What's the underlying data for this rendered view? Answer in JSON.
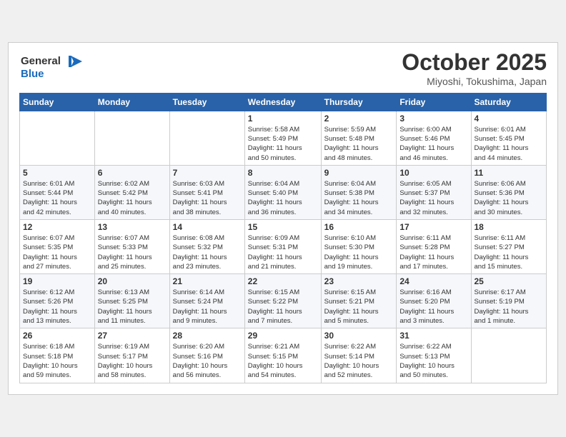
{
  "header": {
    "logo_line1": "General",
    "logo_line2": "Blue",
    "month": "October 2025",
    "location": "Miyoshi, Tokushima, Japan"
  },
  "weekdays": [
    "Sunday",
    "Monday",
    "Tuesday",
    "Wednesday",
    "Thursday",
    "Friday",
    "Saturday"
  ],
  "weeks": [
    [
      {
        "day": "",
        "info": ""
      },
      {
        "day": "",
        "info": ""
      },
      {
        "day": "",
        "info": ""
      },
      {
        "day": "1",
        "info": "Sunrise: 5:58 AM\nSunset: 5:49 PM\nDaylight: 11 hours\nand 50 minutes."
      },
      {
        "day": "2",
        "info": "Sunrise: 5:59 AM\nSunset: 5:48 PM\nDaylight: 11 hours\nand 48 minutes."
      },
      {
        "day": "3",
        "info": "Sunrise: 6:00 AM\nSunset: 5:46 PM\nDaylight: 11 hours\nand 46 minutes."
      },
      {
        "day": "4",
        "info": "Sunrise: 6:01 AM\nSunset: 5:45 PM\nDaylight: 11 hours\nand 44 minutes."
      }
    ],
    [
      {
        "day": "5",
        "info": "Sunrise: 6:01 AM\nSunset: 5:44 PM\nDaylight: 11 hours\nand 42 minutes."
      },
      {
        "day": "6",
        "info": "Sunrise: 6:02 AM\nSunset: 5:42 PM\nDaylight: 11 hours\nand 40 minutes."
      },
      {
        "day": "7",
        "info": "Sunrise: 6:03 AM\nSunset: 5:41 PM\nDaylight: 11 hours\nand 38 minutes."
      },
      {
        "day": "8",
        "info": "Sunrise: 6:04 AM\nSunset: 5:40 PM\nDaylight: 11 hours\nand 36 minutes."
      },
      {
        "day": "9",
        "info": "Sunrise: 6:04 AM\nSunset: 5:38 PM\nDaylight: 11 hours\nand 34 minutes."
      },
      {
        "day": "10",
        "info": "Sunrise: 6:05 AM\nSunset: 5:37 PM\nDaylight: 11 hours\nand 32 minutes."
      },
      {
        "day": "11",
        "info": "Sunrise: 6:06 AM\nSunset: 5:36 PM\nDaylight: 11 hours\nand 30 minutes."
      }
    ],
    [
      {
        "day": "12",
        "info": "Sunrise: 6:07 AM\nSunset: 5:35 PM\nDaylight: 11 hours\nand 27 minutes."
      },
      {
        "day": "13",
        "info": "Sunrise: 6:07 AM\nSunset: 5:33 PM\nDaylight: 11 hours\nand 25 minutes."
      },
      {
        "day": "14",
        "info": "Sunrise: 6:08 AM\nSunset: 5:32 PM\nDaylight: 11 hours\nand 23 minutes."
      },
      {
        "day": "15",
        "info": "Sunrise: 6:09 AM\nSunset: 5:31 PM\nDaylight: 11 hours\nand 21 minutes."
      },
      {
        "day": "16",
        "info": "Sunrise: 6:10 AM\nSunset: 5:30 PM\nDaylight: 11 hours\nand 19 minutes."
      },
      {
        "day": "17",
        "info": "Sunrise: 6:11 AM\nSunset: 5:28 PM\nDaylight: 11 hours\nand 17 minutes."
      },
      {
        "day": "18",
        "info": "Sunrise: 6:11 AM\nSunset: 5:27 PM\nDaylight: 11 hours\nand 15 minutes."
      }
    ],
    [
      {
        "day": "19",
        "info": "Sunrise: 6:12 AM\nSunset: 5:26 PM\nDaylight: 11 hours\nand 13 minutes."
      },
      {
        "day": "20",
        "info": "Sunrise: 6:13 AM\nSunset: 5:25 PM\nDaylight: 11 hours\nand 11 minutes."
      },
      {
        "day": "21",
        "info": "Sunrise: 6:14 AM\nSunset: 5:24 PM\nDaylight: 11 hours\nand 9 minutes."
      },
      {
        "day": "22",
        "info": "Sunrise: 6:15 AM\nSunset: 5:22 PM\nDaylight: 11 hours\nand 7 minutes."
      },
      {
        "day": "23",
        "info": "Sunrise: 6:15 AM\nSunset: 5:21 PM\nDaylight: 11 hours\nand 5 minutes."
      },
      {
        "day": "24",
        "info": "Sunrise: 6:16 AM\nSunset: 5:20 PM\nDaylight: 11 hours\nand 3 minutes."
      },
      {
        "day": "25",
        "info": "Sunrise: 6:17 AM\nSunset: 5:19 PM\nDaylight: 11 hours\nand 1 minute."
      }
    ],
    [
      {
        "day": "26",
        "info": "Sunrise: 6:18 AM\nSunset: 5:18 PM\nDaylight: 10 hours\nand 59 minutes."
      },
      {
        "day": "27",
        "info": "Sunrise: 6:19 AM\nSunset: 5:17 PM\nDaylight: 10 hours\nand 58 minutes."
      },
      {
        "day": "28",
        "info": "Sunrise: 6:20 AM\nSunset: 5:16 PM\nDaylight: 10 hours\nand 56 minutes."
      },
      {
        "day": "29",
        "info": "Sunrise: 6:21 AM\nSunset: 5:15 PM\nDaylight: 10 hours\nand 54 minutes."
      },
      {
        "day": "30",
        "info": "Sunrise: 6:22 AM\nSunset: 5:14 PM\nDaylight: 10 hours\nand 52 minutes."
      },
      {
        "day": "31",
        "info": "Sunrise: 6:22 AM\nSunset: 5:13 PM\nDaylight: 10 hours\nand 50 minutes."
      },
      {
        "day": "",
        "info": ""
      }
    ]
  ]
}
